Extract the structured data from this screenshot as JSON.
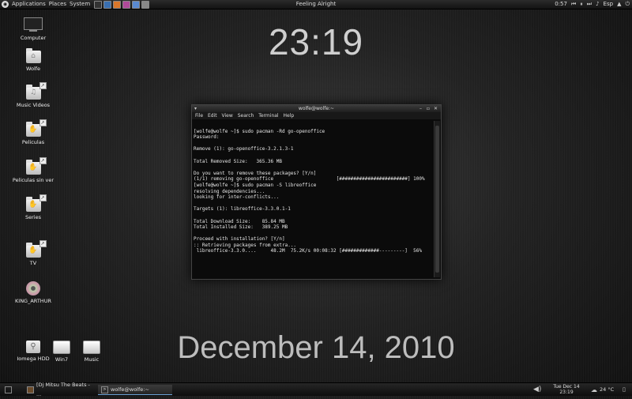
{
  "top_panel": {
    "menus": [
      "Applications",
      "Places",
      "System"
    ],
    "now_playing": "Feeling Alright",
    "time": "0:57",
    "keyboard_layout": "Esp"
  },
  "clock": {
    "time": "23:19",
    "date": "December 14, 2010"
  },
  "desktop_icons": [
    {
      "label": "Computer"
    },
    {
      "label": "Wolfe"
    },
    {
      "label": "Music Videos"
    },
    {
      "label": "Peliculas"
    },
    {
      "label": "Peliculas sin ver"
    },
    {
      "label": "Series"
    },
    {
      "label": "TV"
    },
    {
      "label": "KING_ARTHUR"
    },
    {
      "label": "Iomega HDD"
    },
    {
      "label": "Win7"
    },
    {
      "label": "Music"
    }
  ],
  "terminal": {
    "title": "wolfe@wolfe:~",
    "menu": [
      "File",
      "Edit",
      "View",
      "Search",
      "Terminal",
      "Help"
    ],
    "lines": [
      "[wolfe@wolfe ~]$ sudo pacman -Rd go-openoffice",
      "Password:",
      "",
      "Remove (1): go-openoffice-3.2.1.3-1",
      "",
      "Total Removed Size:   365.36 MB",
      "",
      "Do you want to remove these packages? [Y/n]",
      "(1/1) removing go-openoffice                      [########################] 100%",
      "[wolfe@wolfe ~]$ sudo pacman -S libreoffice",
      "resolving dependencies...",
      "looking for inter-conflicts...",
      "",
      "Targets (1): libreoffice-3.3.0.1-1",
      "",
      "Total Download Size:    85.84 MB",
      "Total Installed Size:   389.25 MB",
      "",
      "Proceed with installation? [Y/n]",
      ":: Retrieving packages from extra...",
      " libreoffice-3.3.0....     48.2M  75.2K/s 00:08:32 [#############---------]  56%"
    ]
  },
  "taskbar": {
    "tasks": [
      {
        "label": "[Dj Mitsu The Beats - ..."
      },
      {
        "label": "wolfe@wolfe:~"
      }
    ],
    "clock_date": "Tue Dec 14",
    "clock_time": "23:19",
    "weather": "24 °C"
  },
  "colors": {
    "panel": "#1a1a1a",
    "terminal_bg": "#0b0b0b",
    "accent": "#6ba3d6"
  }
}
